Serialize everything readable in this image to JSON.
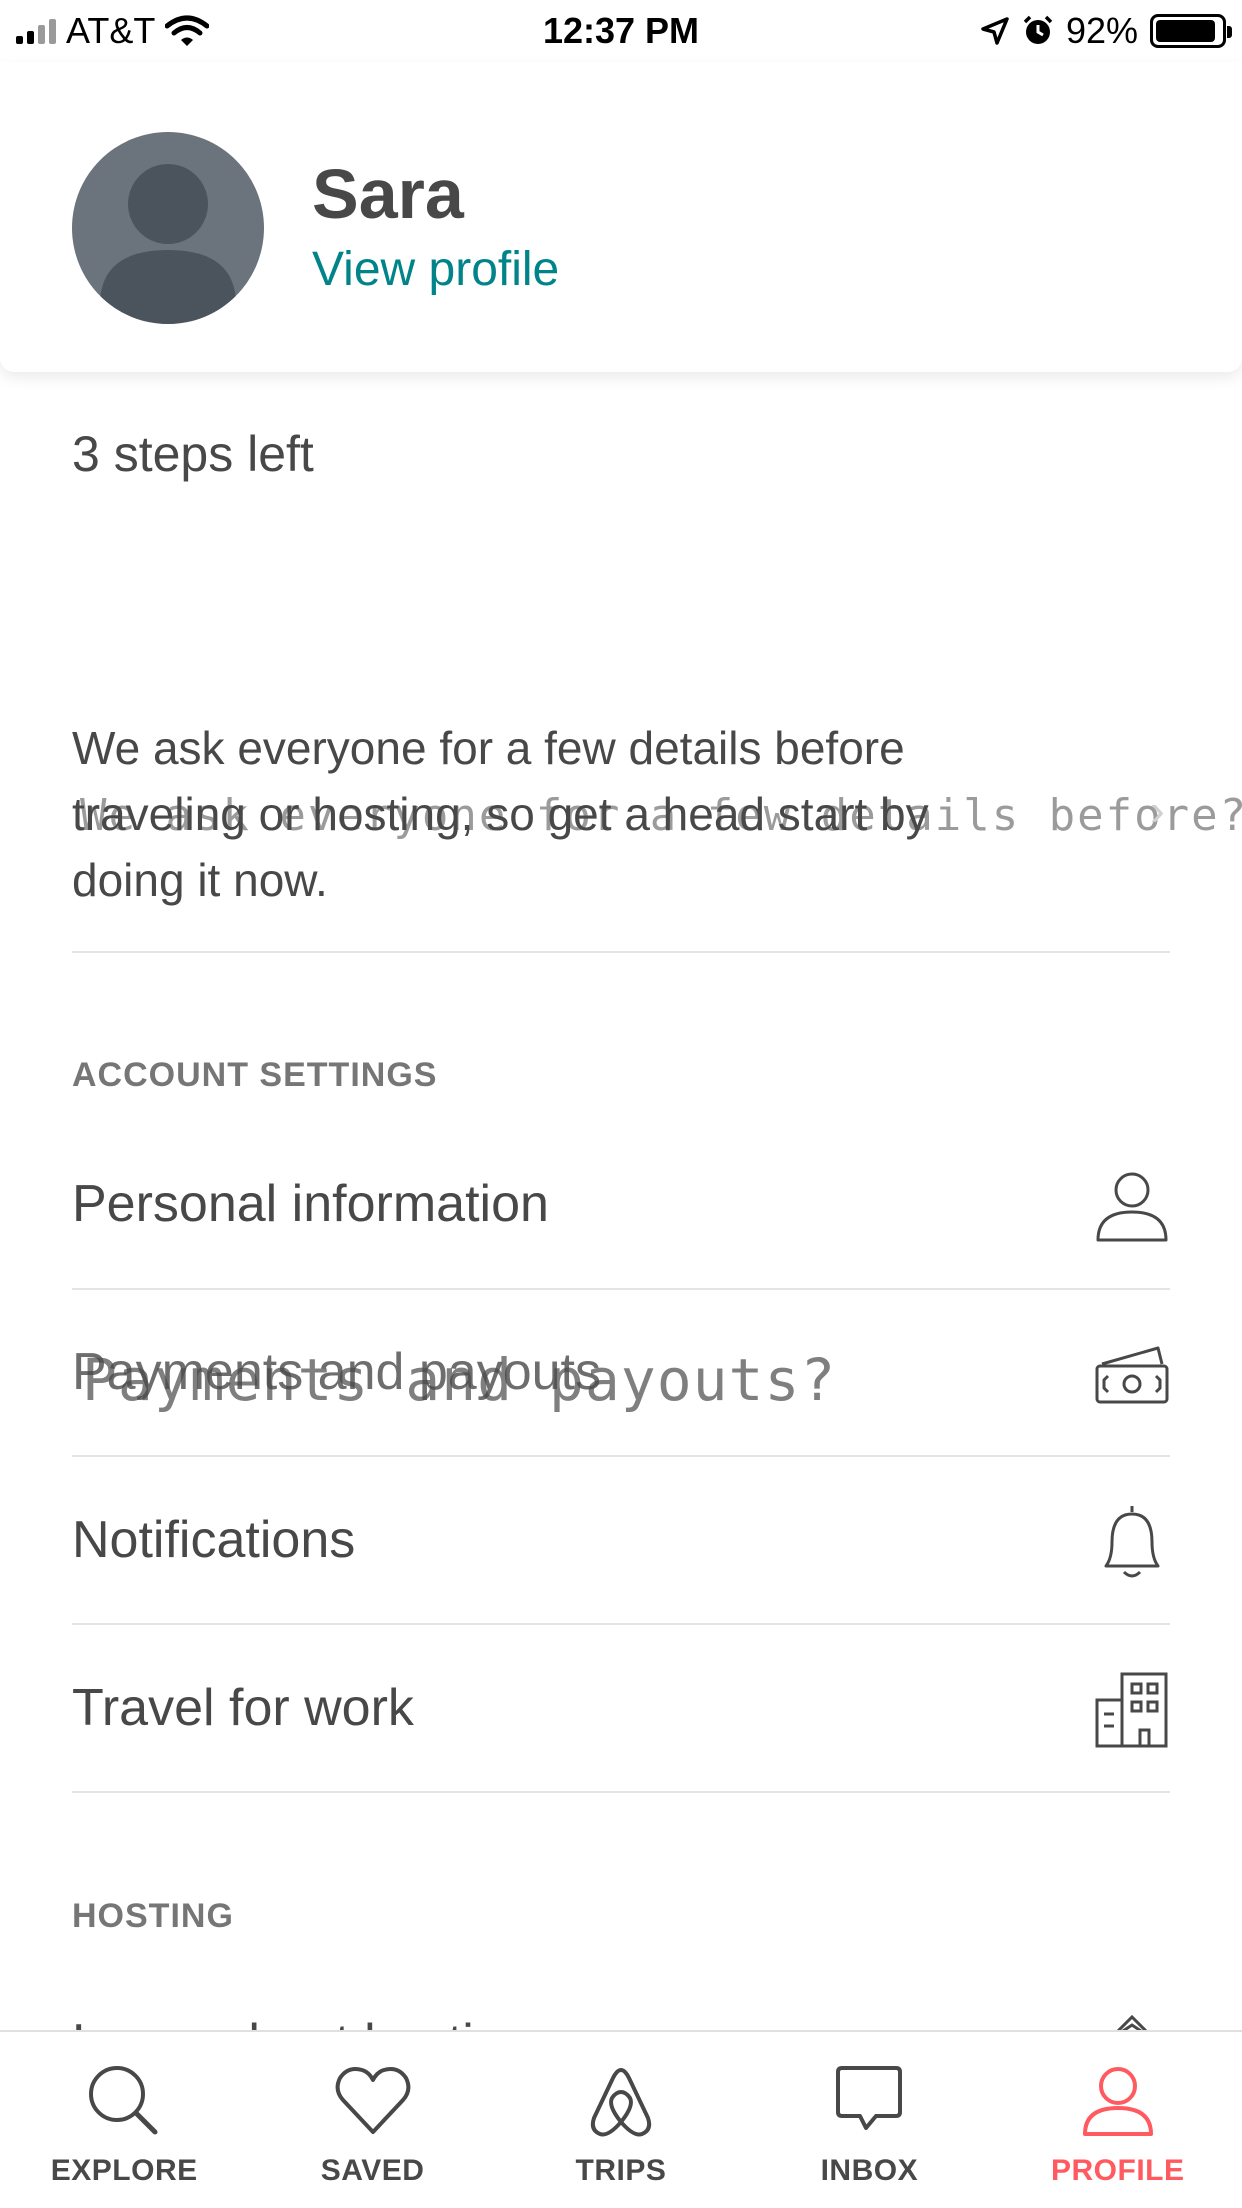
{
  "status_bar": {
    "carrier": "AT&T",
    "time": "12:37 PM",
    "battery": "92%",
    "icons": [
      "signal-icon",
      "wifi-icon",
      "location-arrow-icon",
      "alarm-icon",
      "battery-icon"
    ]
  },
  "profile": {
    "name": "Sara",
    "view_profile_label": "View profile",
    "avatar_icon": "avatar-placeholder-icon"
  },
  "onboarding": {
    "steps_left": "3 steps left",
    "details_text": "We ask everyone for a few details before traveling or hosting, so get a head start by doing it now.",
    "overlay_text": "We ask everyone for a few details before?travelin"
  },
  "account_settings": {
    "title": "ACCOUNT SETTINGS",
    "items": [
      {
        "label": "Personal information",
        "icon": "person-icon"
      },
      {
        "label": "Payments and payouts",
        "overlay": "Payments and payouts?",
        "icon": "money-icon"
      },
      {
        "label": "Notifications",
        "icon": "bell-icon"
      },
      {
        "label": "Travel for work",
        "icon": "building-icon"
      }
    ]
  },
  "hosting": {
    "title": "HOSTING",
    "items": [
      {
        "label": "Learn about hosting",
        "icon": "house-icon"
      }
    ]
  },
  "tab_bar": {
    "tabs": [
      {
        "label": "EXPLORE",
        "icon": "search-icon"
      },
      {
        "label": "SAVED",
        "icon": "heart-icon"
      },
      {
        "label": "TRIPS",
        "icon": "airbnb-logo-icon"
      },
      {
        "label": "INBOX",
        "icon": "chat-bubble-icon"
      },
      {
        "label": "PROFILE",
        "icon": "profile-icon",
        "active": true
      }
    ]
  },
  "colors": {
    "accent_teal": "#008489",
    "active_tab": "#ff5a5f",
    "text": "#484848",
    "muted": "#767676"
  }
}
